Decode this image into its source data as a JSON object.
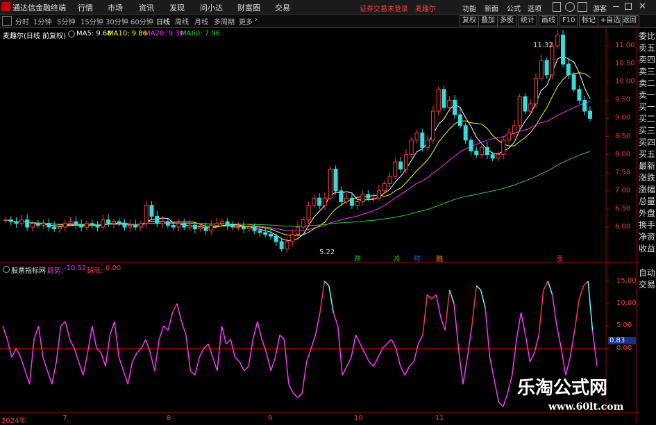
{
  "app": {
    "name": "通达信金融终端"
  },
  "menu": [
    "行情",
    "市场",
    "资讯",
    "发现",
    "问小达",
    "财富圈",
    "交易"
  ],
  "login_status": "证券交易未登录",
  "stock_name_title": "麦趣尔",
  "window_links": [
    "功能",
    "新面",
    "公式",
    "选项"
  ],
  "guest_label": "游客",
  "periods": [
    "分时",
    "1分钟",
    "5分钟",
    "15分钟",
    "30分钟",
    "60分钟",
    "日线",
    "周线",
    "月线",
    "多周期",
    "更多"
  ],
  "active_period": "日线",
  "tools": [
    "复权",
    "叠加",
    "多股",
    "统计",
    "画线",
    "F10",
    "标记",
    "+自选",
    "返回"
  ],
  "price_pane": {
    "stock_label": "麦趣尔(日线 前复权)",
    "ma": [
      {
        "label": "MA5: 9.68",
        "color": "#ffffff"
      },
      {
        "label": "MA10: 9.86",
        "color": "#ffff00"
      },
      {
        "label": "MA20: 9.30",
        "color": "#ff33ff"
      },
      {
        "label": "MA60: 7.96",
        "color": "#33cc33"
      }
    ],
    "y_ticks": [
      "11.00",
      "10.50",
      "10.00",
      "9.50",
      "9.00",
      "8.50",
      "8.00",
      "7.50",
      "7.00",
      "6.50",
      "6.00"
    ],
    "high_label": "11.32",
    "low_label": "5.22",
    "markers": [
      {
        "text": "跌",
        "color": "#22aa22"
      },
      {
        "text": "减",
        "color": "#22aa22"
      },
      {
        "text": "财",
        "color": "#2255ff"
      },
      {
        "text": "融",
        "color": "#ff8800"
      },
      {
        "text": "涨",
        "color": "#ff3333"
      }
    ]
  },
  "right_panel": [
    "委比",
    "卖五",
    "卖四",
    "卖三",
    "卖二",
    "卖一",
    "买一",
    "买二",
    "买三",
    "买四",
    "买五",
    "最新",
    "涨跌",
    "涨幅",
    "总量",
    "外盘",
    "换手",
    "净资",
    "收益"
  ],
  "right_panel_lower": [
    "自动",
    "交易"
  ],
  "indicator_pane": {
    "name": "股票指标网",
    "trend_label": "趋势:",
    "trend_value": "-10.52",
    "ref_label": "超涨:",
    "ref_value": "0.00",
    "y_ticks": [
      "15.00",
      "10.00",
      "5.00",
      "0.00"
    ],
    "current_value": "0.83"
  },
  "x_labels": [
    "2024年",
    "7",
    "8",
    "9",
    "10",
    "11"
  ],
  "watermark": {
    "title": "乐淘公式网",
    "url": "www.60lt.com"
  },
  "chart_data": [
    {
      "type": "candlestick",
      "title": "麦趣尔(日线 前复权)",
      "ylim": [
        5.1,
        11.5
      ],
      "close": [
        6.2,
        6.15,
        6.1,
        6.2,
        6.0,
        6.1,
        6.05,
        6.1,
        6.0,
        5.95,
        6.0,
        6.1,
        6.15,
        6.05,
        6.0,
        6.1,
        6.05,
        6.0,
        6.2,
        6.1,
        6.15,
        6.1,
        6.0,
        6.05,
        6.0,
        6.1,
        6.6,
        6.3,
        6.1,
        6.15,
        6.05,
        6.0,
        6.1,
        6.0,
        6.05,
        5.95,
        6.0,
        5.9,
        6.05,
        6.1,
        6.15,
        6.05,
        6.0,
        6.0,
        5.95,
        6.0,
        5.9,
        5.85,
        5.8,
        5.75,
        5.6,
        5.4,
        5.6,
        5.8,
        6.0,
        6.2,
        6.6,
        6.8,
        6.6,
        6.8,
        7.6,
        7.0,
        6.7,
        6.8,
        6.6,
        6.7,
        6.9,
        6.8,
        6.8,
        7.0,
        7.2,
        7.4,
        7.8,
        7.6,
        8.0,
        8.4,
        8.6,
        8.2,
        8.4,
        9.2,
        9.8,
        9.3,
        9.5,
        9.1,
        8.8,
        8.4,
        8.1,
        8.0,
        8.2,
        8.0,
        7.9,
        8.0,
        8.4,
        8.6,
        8.8,
        9.6,
        9.2,
        9.4,
        10.1,
        10.6,
        10.2,
        11.0,
        11.3,
        10.5,
        10.2,
        9.8,
        9.5,
        9.2,
        9.0
      ]
    },
    {
      "type": "line",
      "name": "趋势",
      "values": [
        5,
        2,
        -2,
        0,
        -2,
        -5,
        -8,
        2,
        5,
        -2,
        -5,
        -8,
        -3,
        5,
        6,
        2,
        0,
        -3,
        -6,
        -1,
        5,
        0,
        -1,
        -4,
        3,
        6,
        -2,
        -5,
        -8,
        -3,
        -1,
        0,
        2,
        -1,
        -5,
        2,
        5,
        4,
        8,
        10,
        6,
        3,
        -5,
        -6,
        -2,
        0,
        1,
        -2,
        -5,
        5,
        1,
        2,
        -2,
        -3,
        -5,
        -4,
        2,
        6,
        2,
        -1,
        -5,
        -2,
        3,
        2,
        -8,
        -10,
        -11,
        -10,
        -3,
        0,
        3,
        8,
        15,
        14,
        8,
        5,
        -6,
        -4,
        -2,
        3,
        1,
        -1,
        -3,
        -4,
        -2,
        0,
        1,
        2,
        0,
        -4,
        -6,
        -4,
        -3,
        1,
        3,
        12,
        11,
        12,
        7,
        4,
        13,
        10,
        0,
        -8,
        -2,
        5,
        14,
        13,
        9,
        -2,
        -7,
        -12,
        -13,
        -10,
        -6,
        2,
        8,
        3,
        -3,
        -1,
        3,
        13,
        15,
        12,
        5,
        0,
        -6,
        -2,
        4,
        11,
        14,
        15,
        4,
        -4
      ]
    }
  ]
}
